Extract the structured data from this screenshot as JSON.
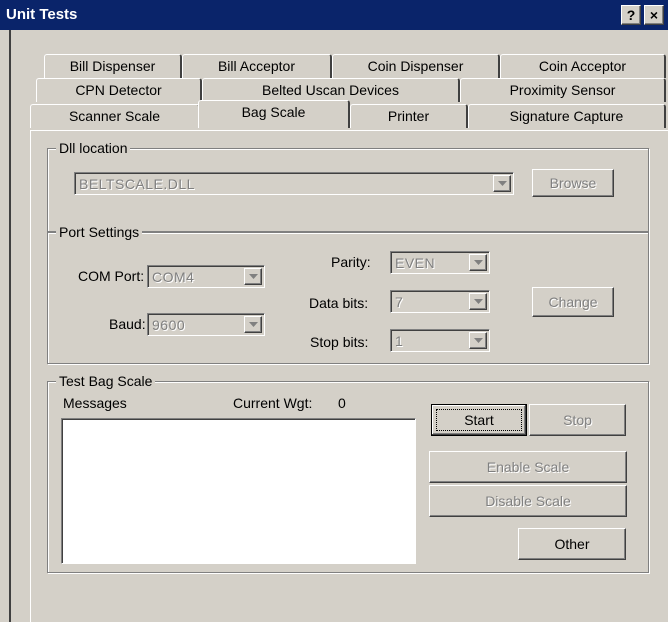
{
  "window": {
    "title": "Unit Tests",
    "help_label": "?",
    "close_label": "×"
  },
  "tabs": {
    "row1": [
      "Bill Dispenser",
      "Bill Acceptor",
      "Coin Dispenser",
      "Coin Acceptor"
    ],
    "row2": [
      "CPN Detector",
      "Belted Uscan Devices",
      "Proximity Sensor"
    ],
    "row3": [
      "Scanner Scale",
      "Bag Scale",
      "Printer",
      "Signature Capture"
    ],
    "selected": "Bag Scale"
  },
  "dll_location": {
    "legend": "Dll location",
    "value": "BELTSCALE.DLL",
    "browse_label": "Browse"
  },
  "port_settings": {
    "legend": "Port Settings",
    "com_port_label": "COM Port:",
    "com_port_value": "COM4",
    "baud_label": "Baud:",
    "baud_value": "9600",
    "parity_label": "Parity:",
    "parity_value": "EVEN",
    "data_bits_label": "Data bits:",
    "data_bits_value": "7",
    "stop_bits_label": "Stop bits:",
    "stop_bits_value": "1",
    "change_label": "Change"
  },
  "test_bag_scale": {
    "legend": "Test Bag Scale",
    "messages_label": "Messages",
    "current_wgt_label": "Current Wgt:",
    "current_wgt_value": "0",
    "messages_text": "",
    "start_label": "Start",
    "stop_label": "Stop",
    "enable_scale_label": "Enable Scale",
    "disable_scale_label": "Disable Scale",
    "other_label": "Other"
  }
}
